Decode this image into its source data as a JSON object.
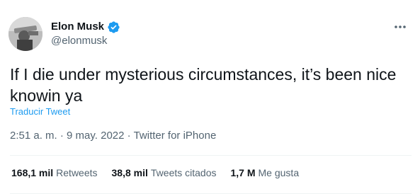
{
  "user": {
    "display_name": "Elon Musk",
    "handle": "@elonmusk",
    "verified": true
  },
  "tweet": {
    "text": "If I die under mysterious circumstances, it’s been nice knowin ya",
    "translate_label": "Traducir Tweet",
    "time": "2:51 a. m.",
    "separator": "·",
    "date": "9 may. 2022",
    "source": "Twitter for iPhone"
  },
  "stats": [
    {
      "count": "168,1 mil",
      "label": "Retweets"
    },
    {
      "count": "38,8 mil",
      "label": "Tweets citados"
    },
    {
      "count": "1,7 M",
      "label": "Me gusta"
    }
  ],
  "colors": {
    "accent": "#1d9bf0",
    "text": "#0f1419",
    "muted": "#536471"
  },
  "icons": {
    "more": "more-horizontal-icon",
    "verified": "verified-badge-icon"
  }
}
